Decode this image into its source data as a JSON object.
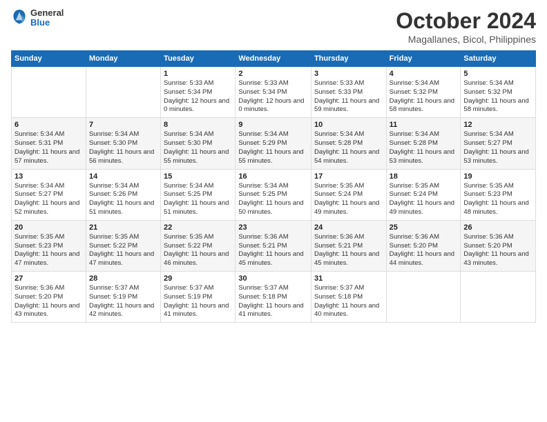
{
  "logo": {
    "general": "General",
    "blue": "Blue"
  },
  "title": "October 2024",
  "subtitle": "Magallanes, Bicol, Philippines",
  "weekdays": [
    "Sunday",
    "Monday",
    "Tuesday",
    "Wednesday",
    "Thursday",
    "Friday",
    "Saturday"
  ],
  "weeks": [
    [
      {
        "day": "",
        "info": ""
      },
      {
        "day": "",
        "info": ""
      },
      {
        "day": "1",
        "info": "Sunrise: 5:33 AM\nSunset: 5:34 PM\nDaylight: 12 hours\nand 0 minutes."
      },
      {
        "day": "2",
        "info": "Sunrise: 5:33 AM\nSunset: 5:34 PM\nDaylight: 12 hours\nand 0 minutes."
      },
      {
        "day": "3",
        "info": "Sunrise: 5:33 AM\nSunset: 5:33 PM\nDaylight: 11 hours\nand 59 minutes."
      },
      {
        "day": "4",
        "info": "Sunrise: 5:34 AM\nSunset: 5:32 PM\nDaylight: 11 hours\nand 58 minutes."
      },
      {
        "day": "5",
        "info": "Sunrise: 5:34 AM\nSunset: 5:32 PM\nDaylight: 11 hours\nand 58 minutes."
      }
    ],
    [
      {
        "day": "6",
        "info": "Sunrise: 5:34 AM\nSunset: 5:31 PM\nDaylight: 11 hours\nand 57 minutes."
      },
      {
        "day": "7",
        "info": "Sunrise: 5:34 AM\nSunset: 5:30 PM\nDaylight: 11 hours\nand 56 minutes."
      },
      {
        "day": "8",
        "info": "Sunrise: 5:34 AM\nSunset: 5:30 PM\nDaylight: 11 hours\nand 55 minutes."
      },
      {
        "day": "9",
        "info": "Sunrise: 5:34 AM\nSunset: 5:29 PM\nDaylight: 11 hours\nand 55 minutes."
      },
      {
        "day": "10",
        "info": "Sunrise: 5:34 AM\nSunset: 5:28 PM\nDaylight: 11 hours\nand 54 minutes."
      },
      {
        "day": "11",
        "info": "Sunrise: 5:34 AM\nSunset: 5:28 PM\nDaylight: 11 hours\nand 53 minutes."
      },
      {
        "day": "12",
        "info": "Sunrise: 5:34 AM\nSunset: 5:27 PM\nDaylight: 11 hours\nand 53 minutes."
      }
    ],
    [
      {
        "day": "13",
        "info": "Sunrise: 5:34 AM\nSunset: 5:27 PM\nDaylight: 11 hours\nand 52 minutes."
      },
      {
        "day": "14",
        "info": "Sunrise: 5:34 AM\nSunset: 5:26 PM\nDaylight: 11 hours\nand 51 minutes."
      },
      {
        "day": "15",
        "info": "Sunrise: 5:34 AM\nSunset: 5:25 PM\nDaylight: 11 hours\nand 51 minutes."
      },
      {
        "day": "16",
        "info": "Sunrise: 5:34 AM\nSunset: 5:25 PM\nDaylight: 11 hours\nand 50 minutes."
      },
      {
        "day": "17",
        "info": "Sunrise: 5:35 AM\nSunset: 5:24 PM\nDaylight: 11 hours\nand 49 minutes."
      },
      {
        "day": "18",
        "info": "Sunrise: 5:35 AM\nSunset: 5:24 PM\nDaylight: 11 hours\nand 49 minutes."
      },
      {
        "day": "19",
        "info": "Sunrise: 5:35 AM\nSunset: 5:23 PM\nDaylight: 11 hours\nand 48 minutes."
      }
    ],
    [
      {
        "day": "20",
        "info": "Sunrise: 5:35 AM\nSunset: 5:23 PM\nDaylight: 11 hours\nand 47 minutes."
      },
      {
        "day": "21",
        "info": "Sunrise: 5:35 AM\nSunset: 5:22 PM\nDaylight: 11 hours\nand 47 minutes."
      },
      {
        "day": "22",
        "info": "Sunrise: 5:35 AM\nSunset: 5:22 PM\nDaylight: 11 hours\nand 46 minutes."
      },
      {
        "day": "23",
        "info": "Sunrise: 5:36 AM\nSunset: 5:21 PM\nDaylight: 11 hours\nand 45 minutes."
      },
      {
        "day": "24",
        "info": "Sunrise: 5:36 AM\nSunset: 5:21 PM\nDaylight: 11 hours\nand 45 minutes."
      },
      {
        "day": "25",
        "info": "Sunrise: 5:36 AM\nSunset: 5:20 PM\nDaylight: 11 hours\nand 44 minutes."
      },
      {
        "day": "26",
        "info": "Sunrise: 5:36 AM\nSunset: 5:20 PM\nDaylight: 11 hours\nand 43 minutes."
      }
    ],
    [
      {
        "day": "27",
        "info": "Sunrise: 5:36 AM\nSunset: 5:20 PM\nDaylight: 11 hours\nand 43 minutes."
      },
      {
        "day": "28",
        "info": "Sunrise: 5:37 AM\nSunset: 5:19 PM\nDaylight: 11 hours\nand 42 minutes."
      },
      {
        "day": "29",
        "info": "Sunrise: 5:37 AM\nSunset: 5:19 PM\nDaylight: 11 hours\nand 41 minutes."
      },
      {
        "day": "30",
        "info": "Sunrise: 5:37 AM\nSunset: 5:18 PM\nDaylight: 11 hours\nand 41 minutes."
      },
      {
        "day": "31",
        "info": "Sunrise: 5:37 AM\nSunset: 5:18 PM\nDaylight: 11 hours\nand 40 minutes."
      },
      {
        "day": "",
        "info": ""
      },
      {
        "day": "",
        "info": ""
      }
    ]
  ]
}
